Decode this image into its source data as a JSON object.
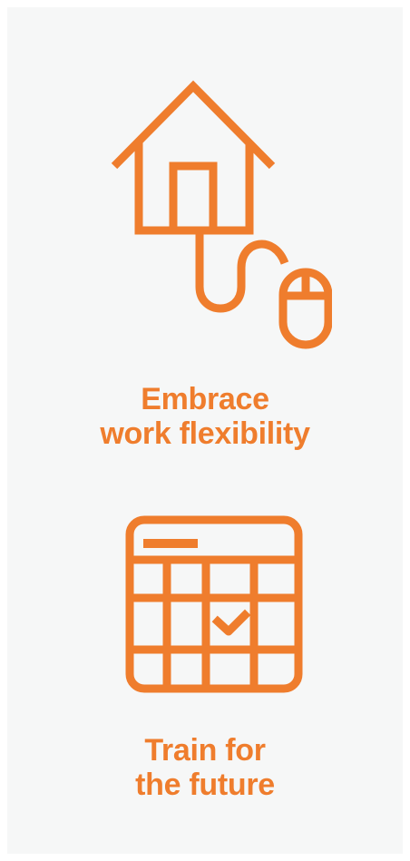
{
  "colors": {
    "accent": "#ef7d2d",
    "background": "#f6f7f7"
  },
  "features": [
    {
      "icon": "house-with-mouse-icon",
      "title_line1": "Embrace",
      "title_line2": "work flexibility"
    },
    {
      "icon": "calendar-check-icon",
      "title_line1": "Train for",
      "title_line2": "the future"
    }
  ]
}
